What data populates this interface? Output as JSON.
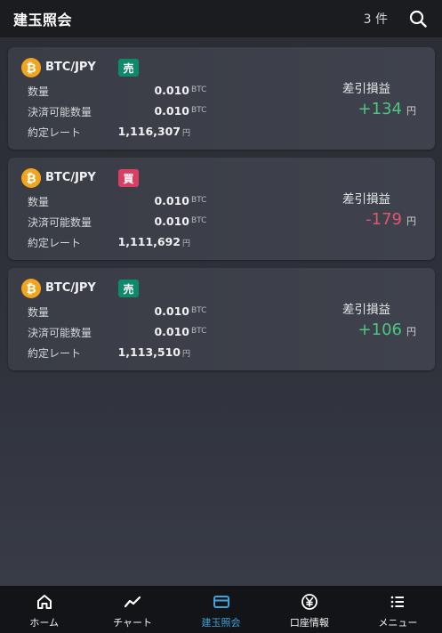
{
  "header": {
    "title": "建玉照会",
    "count": "3 件"
  },
  "positions": [
    {
      "pair": "BTC/JPY",
      "side": "売",
      "side_color": "#0e8a6a",
      "coin_symbol": "₿",
      "rows": [
        {
          "label": "数量",
          "value": "0.010",
          "unit": "BTC"
        },
        {
          "label": "決済可能数量",
          "value": "0.010",
          "unit": "BTC"
        },
        {
          "label": "約定レート",
          "value": "1,116,307",
          "unit": "円"
        }
      ],
      "pl_label": "差引損益",
      "pl_value": "+134",
      "pl_unit": "円",
      "pl_color": "#4cc77e"
    },
    {
      "pair": "BTC/JPY",
      "side": "買",
      "side_color": "#d83f63",
      "coin_symbol": "₿",
      "rows": [
        {
          "label": "数量",
          "value": "0.010",
          "unit": "BTC"
        },
        {
          "label": "決済可能数量",
          "value": "0.010",
          "unit": "BTC"
        },
        {
          "label": "約定レート",
          "value": "1,111,692",
          "unit": "円"
        }
      ],
      "pl_label": "差引損益",
      "pl_value": "-179",
      "pl_unit": "円",
      "pl_color": "#e0566f"
    },
    {
      "pair": "BTC/JPY",
      "side": "売",
      "side_color": "#0e8a6a",
      "coin_symbol": "₿",
      "rows": [
        {
          "label": "数量",
          "value": "0.010",
          "unit": "BTC"
        },
        {
          "label": "決済可能数量",
          "value": "0.010",
          "unit": "BTC"
        },
        {
          "label": "約定レート",
          "value": "1,113,510",
          "unit": "円"
        }
      ],
      "pl_label": "差引損益",
      "pl_value": "+106",
      "pl_unit": "円",
      "pl_color": "#4cc77e"
    }
  ],
  "nav": {
    "items": [
      {
        "label": "ホーム",
        "icon": "home-icon"
      },
      {
        "label": "チャート",
        "icon": "chart-icon"
      },
      {
        "label": "建玉照会",
        "icon": "card-icon",
        "active": true
      },
      {
        "label": "口座情報",
        "icon": "yen-icon"
      },
      {
        "label": "メニュー",
        "icon": "menu-icon"
      }
    ]
  },
  "colors": {
    "accent": "#3ca3dc",
    "bitcoin": "#f2a41f"
  }
}
